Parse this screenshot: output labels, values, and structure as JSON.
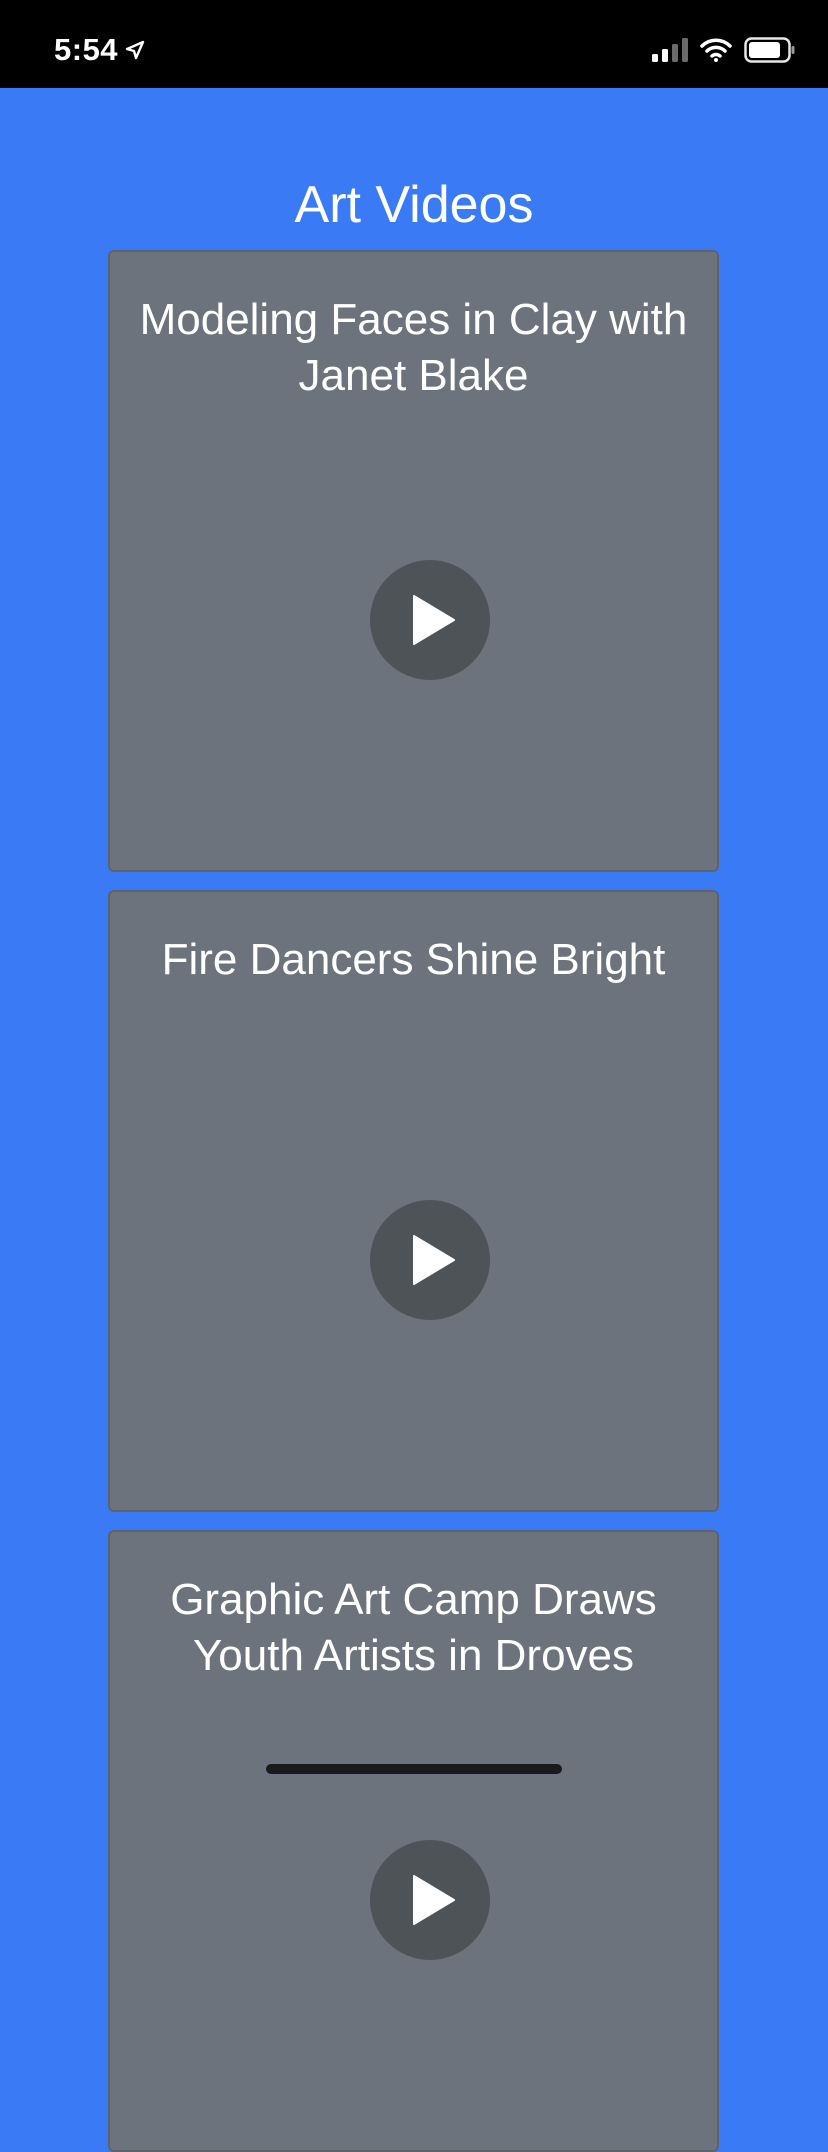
{
  "status_bar": {
    "time": "5:54",
    "icons": [
      "location-arrow-icon",
      "cellular-signal-icon",
      "wifi-icon",
      "battery-icon"
    ]
  },
  "header": {
    "title": "Art Videos"
  },
  "videos": [
    {
      "title": "Modeling Faces in Clay with Janet Blake",
      "play_icon": "play-icon"
    },
    {
      "title": "Fire Dancers Shine Bright",
      "play_icon": "play-icon"
    },
    {
      "title": "Graphic Art Camp Draws Youth Artists in Droves",
      "play_icon": "play-icon"
    }
  ],
  "colors": {
    "background": "#3A7BF5",
    "card": "#6C737C",
    "play_button": "#4E5358",
    "status_bar": "#000000",
    "text": "#FFFFFF"
  }
}
